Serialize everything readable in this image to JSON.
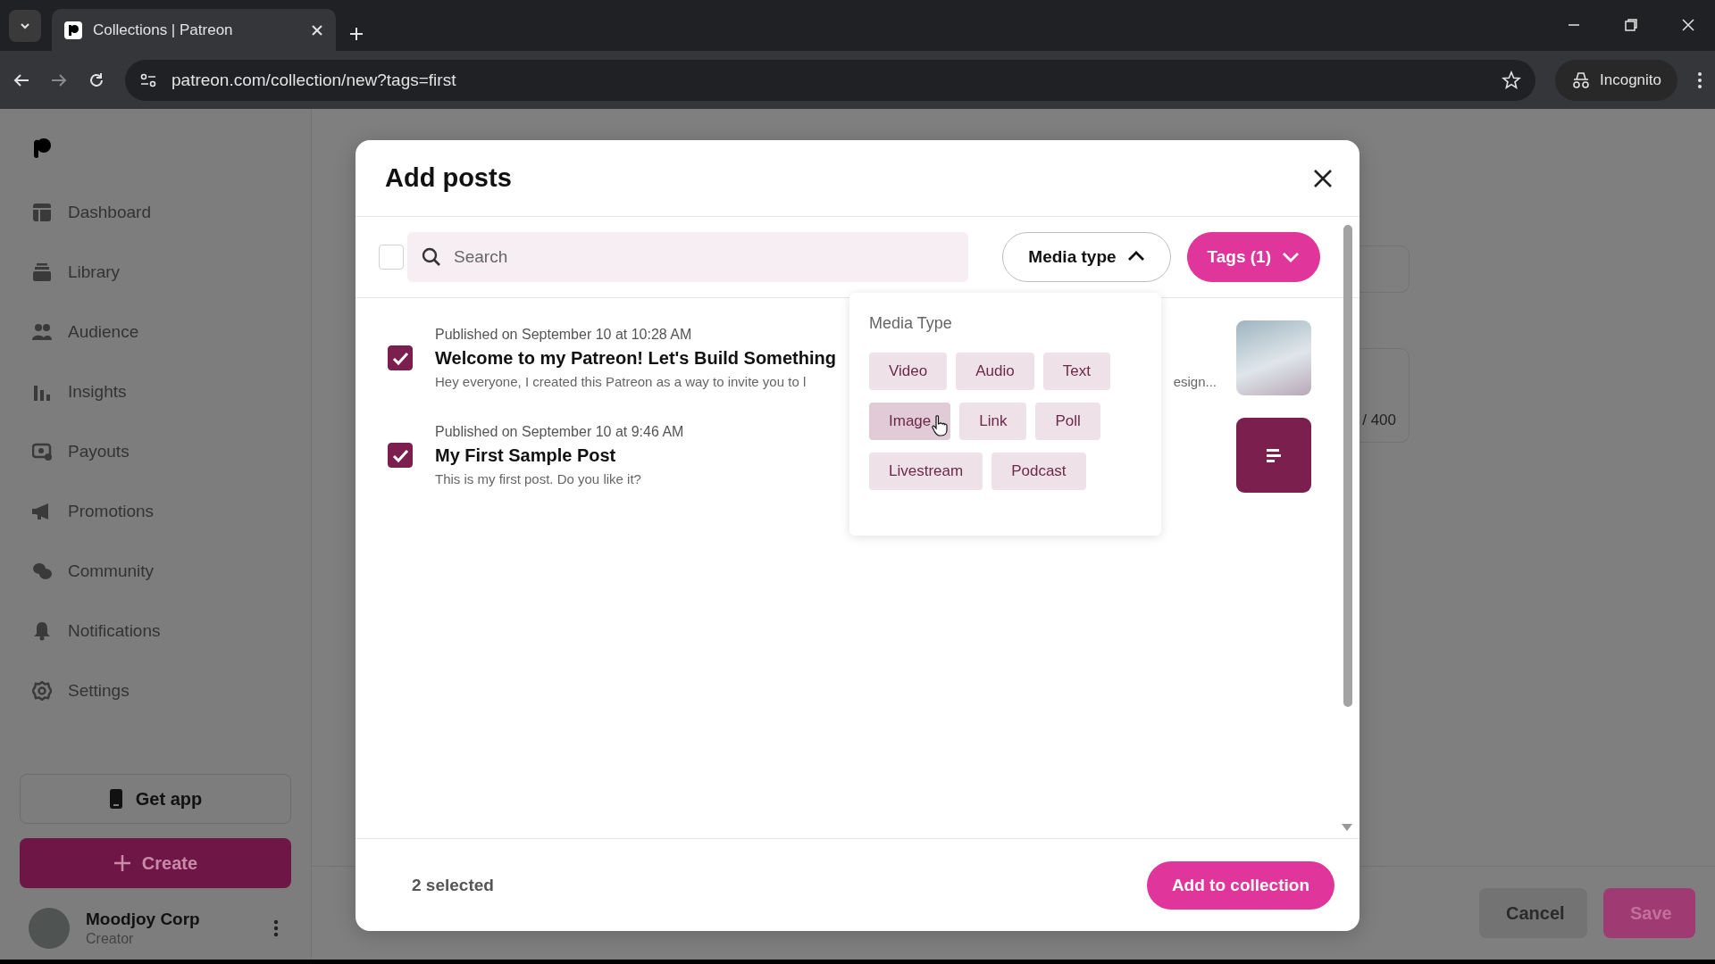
{
  "browser": {
    "tab": {
      "title": "Collections | Patreon"
    },
    "address": "patreon.com/collection/new?tags=first",
    "profile": "Incognito"
  },
  "sidebar": {
    "items": [
      {
        "label": "Dashboard"
      },
      {
        "label": "Library"
      },
      {
        "label": "Audience"
      },
      {
        "label": "Insights"
      },
      {
        "label": "Payouts"
      },
      {
        "label": "Promotions"
      },
      {
        "label": "Community"
      },
      {
        "label": "Notifications"
      },
      {
        "label": "Settings"
      }
    ],
    "get_app": "Get app",
    "create": "Create",
    "user": {
      "name": "Moodjoy Corp",
      "role": "Creator"
    }
  },
  "page": {
    "character_count": "/ 400",
    "buttons": [
      {
        "label": "Cancel",
        "kind": "secondary"
      },
      {
        "label": "Save",
        "kind": "primary"
      }
    ]
  },
  "modal": {
    "title": "Add posts",
    "select_all": {
      "checked": false
    },
    "search": {
      "placeholder": "Search"
    },
    "filters": [
      {
        "label": "Media type",
        "kind": "outline",
        "expanded": true
      },
      {
        "label": "Tags (1)",
        "kind": "filled",
        "expanded": false
      }
    ],
    "media_menu": {
      "title": "Media Type",
      "options": [
        {
          "label": "Video",
          "hovered": false
        },
        {
          "label": "Audio",
          "hovered": false
        },
        {
          "label": "Text",
          "hovered": false
        },
        {
          "label": "Image",
          "hovered": true
        },
        {
          "label": "Link",
          "hovered": false
        },
        {
          "label": "Poll",
          "hovered": false
        },
        {
          "label": "Livestream",
          "hovered": false
        },
        {
          "label": "Podcast",
          "hovered": false
        }
      ]
    },
    "posts": [
      {
        "published": "Published on September 10 at 10:28 AM",
        "title": "Welcome to my Patreon! Let's Build Something",
        "excerpt": [
          "Hey everyone, I created this Patreon as a way to invite you to l",
          "esign..."
        ],
        "checked": true,
        "kind": "image"
      },
      {
        "published": "Published on September 10 at 9:46 AM",
        "title": "My First Sample Post",
        "excerpt": [
          "This is my first post. Do you like it?"
        ],
        "checked": true,
        "kind": "text"
      }
    ],
    "selected_count": "2 selected",
    "add_button": "Add to collection"
  }
}
